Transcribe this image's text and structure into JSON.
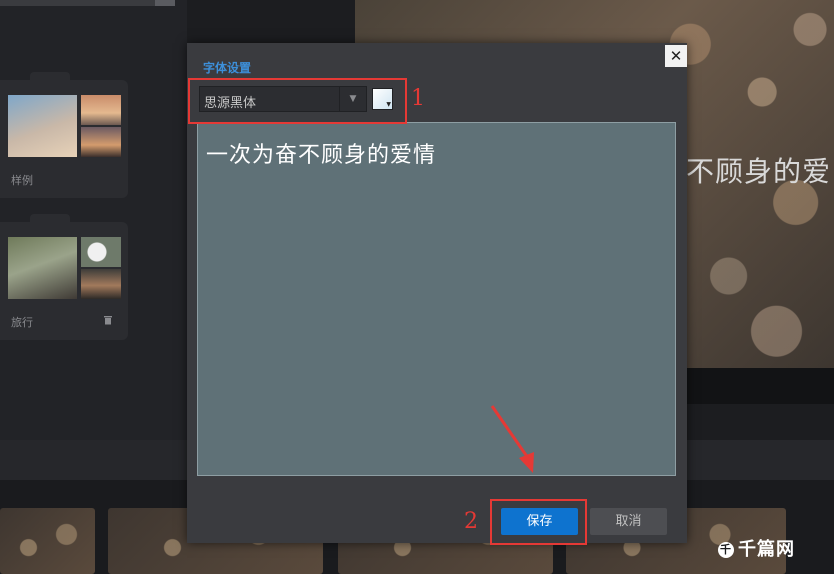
{
  "albums": [
    {
      "name": "样例"
    },
    {
      "name": "旅行",
      "action_icon": "trash-icon"
    }
  ],
  "preview": {
    "text": "不顾身的爱"
  },
  "watermark": {
    "logo_glyph": "千",
    "text": "千篇网"
  },
  "dialog": {
    "title": "字体设置",
    "close_label": "✕",
    "font": {
      "selected": "思源黑体",
      "arrow": "▼"
    },
    "text_content": "一次为奋不顾身的爱情",
    "save_label": "保存",
    "cancel_label": "取消"
  },
  "annotations": {
    "step1": "1",
    "step2": "2"
  },
  "colors": {
    "accent": "#3d8fd9",
    "primary_button": "#0e73cf",
    "annotation": "#e53935"
  }
}
